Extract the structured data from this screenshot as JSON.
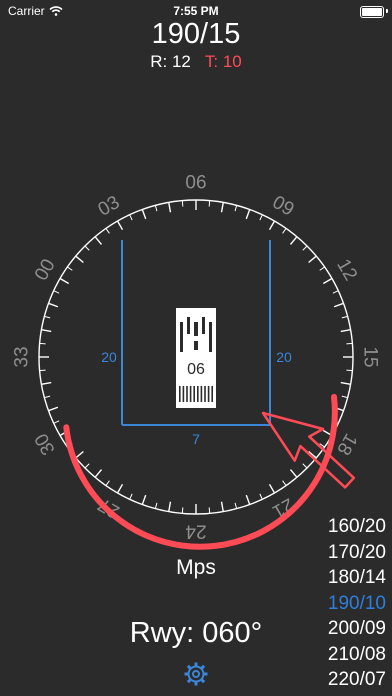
{
  "status": {
    "carrier": "Carrier",
    "time": "7:55 PM"
  },
  "wind": {
    "current": "190/15",
    "r_label": "R: 12",
    "t_label": "T: 10"
  },
  "compass": {
    "labels": [
      "06",
      "09",
      "12",
      "15",
      "18",
      "21",
      "24",
      "27",
      "30",
      "33",
      "00",
      "03"
    ]
  },
  "runway": {
    "designator": "06",
    "left_distance": "20",
    "right_distance": "20",
    "bottom_distance": "7"
  },
  "units": "Mps",
  "runway_heading": "Rwy: 060°",
  "wind_list": {
    "items": [
      "160/20",
      "170/20",
      "180/14",
      "190/10",
      "200/09",
      "210/08",
      "220/07"
    ],
    "selected_index": 3
  },
  "colors": {
    "accent_blue": "#3b86d9",
    "tail_red": "#ff4b55",
    "background": "#2b2b2b"
  },
  "icons": {
    "signal": "wifi-icon",
    "settings": "gear-icon"
  }
}
